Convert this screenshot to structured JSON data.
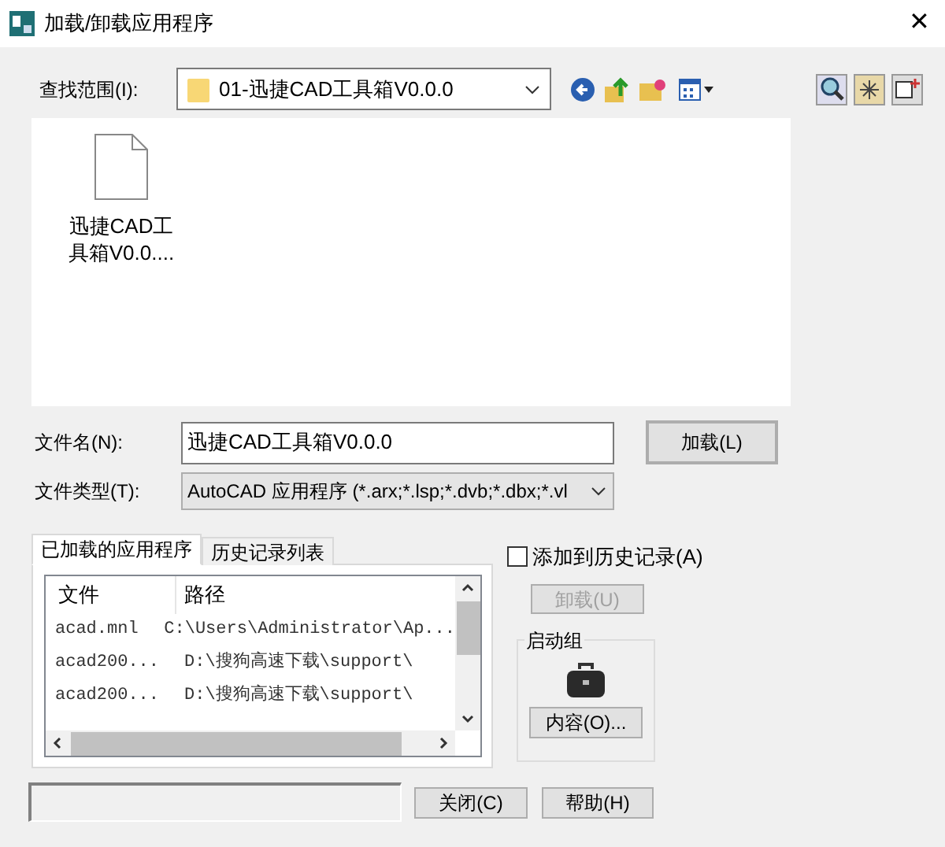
{
  "window": {
    "title": "加载/卸载应用程序",
    "close": "✕"
  },
  "look_in": {
    "label": "查找范围(I):",
    "value": "01-迅捷CAD工具箱V0.0.0"
  },
  "files": [
    {
      "name": "迅捷CAD工具箱V0.0....",
      "selected": false
    }
  ],
  "file_name": {
    "label": "文件名(N):",
    "value": "迅捷CAD工具箱V0.0.0"
  },
  "load_button": "加载(L)",
  "file_type": {
    "label": "文件类型(T):",
    "value": "AutoCAD 应用程序 (*.arx;*.lsp;*.dvb;*.dbx;*.vl"
  },
  "tabs": [
    {
      "label": "已加载的应用程序",
      "selected": true
    },
    {
      "label": "历史记录列表",
      "selected": false
    }
  ],
  "list": {
    "columns": [
      "文件",
      "路径"
    ],
    "rows": [
      [
        "acad.mnl",
        "C:\\Users\\Administrator\\Ap..."
      ],
      [
        "acad200...",
        "D:\\搜狗高速下载\\support\\"
      ],
      [
        "acad200...",
        "D:\\搜狗高速下载\\support\\"
      ]
    ]
  },
  "add_to_history": {
    "label": "添加到历史记录(A)",
    "checked": false
  },
  "unload_button": {
    "label": "卸载(U)",
    "disabled": true
  },
  "startup_group": {
    "title": "启动组",
    "button": "内容(O)..."
  },
  "buttons": [
    "关闭(C)",
    "帮助(H)"
  ]
}
